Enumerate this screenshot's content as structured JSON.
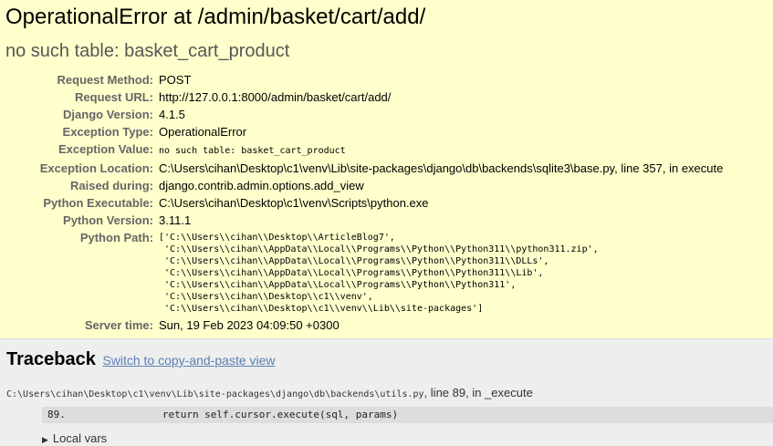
{
  "summary": {
    "title": "OperationalError at /admin/basket/cart/add/",
    "subtitle": "no such table: basket_cart_product",
    "rows": [
      {
        "label": "Request Method:",
        "value": "POST"
      },
      {
        "label": "Request URL:",
        "value": "http://127.0.0.1:8000/admin/basket/cart/add/"
      },
      {
        "label": "Django Version:",
        "value": "4.1.5"
      },
      {
        "label": "Exception Type:",
        "value": "OperationalError"
      },
      {
        "label": "Exception Value:",
        "value": "no such table: basket_cart_product"
      },
      {
        "label": "Exception Location:",
        "value": "C:\\Users\\cihan\\Desktop\\c1\\venv\\Lib\\site-packages\\django\\db\\backends\\sqlite3\\base.py, line 357, in execute"
      },
      {
        "label": "Raised during:",
        "value": "django.contrib.admin.options.add_view"
      },
      {
        "label": "Python Executable:",
        "value": "C:\\Users\\cihan\\Desktop\\c1\\venv\\Scripts\\python.exe"
      },
      {
        "label": "Python Version:",
        "value": "3.11.1"
      },
      {
        "label": "Python Path:",
        "value": "['C:\\\\Users\\\\cihan\\\\Desktop\\\\ArticleBlog7',\n 'C:\\\\Users\\\\cihan\\\\AppData\\\\Local\\\\Programs\\\\Python\\\\Python311\\\\python311.zip',\n 'C:\\\\Users\\\\cihan\\\\AppData\\\\Local\\\\Programs\\\\Python\\\\Python311\\\\DLLs',\n 'C:\\\\Users\\\\cihan\\\\AppData\\\\Local\\\\Programs\\\\Python\\\\Python311\\\\Lib',\n 'C:\\\\Users\\\\cihan\\\\AppData\\\\Local\\\\Programs\\\\Python\\\\Python311',\n 'C:\\\\Users\\\\cihan\\\\Desktop\\\\c1\\\\venv',\n 'C:\\\\Users\\\\cihan\\\\Desktop\\\\c1\\\\venv\\\\Lib\\\\site-packages']"
      },
      {
        "label": "Server time:",
        "value": "Sun, 19 Feb 2023 04:09:50 +0300"
      }
    ]
  },
  "traceback": {
    "heading": "Traceback",
    "switch_link": "Switch to copy-and-paste view",
    "frame": {
      "file": "C:\\Users\\cihan\\Desktop\\c1\\venv\\Lib\\site-packages\\django\\db\\backends\\utils.py",
      "location": ", line 89, in _execute",
      "context_line": "89.                return self.cursor.execute(sql, params)",
      "local_vars_label": "Local vars"
    }
  }
}
